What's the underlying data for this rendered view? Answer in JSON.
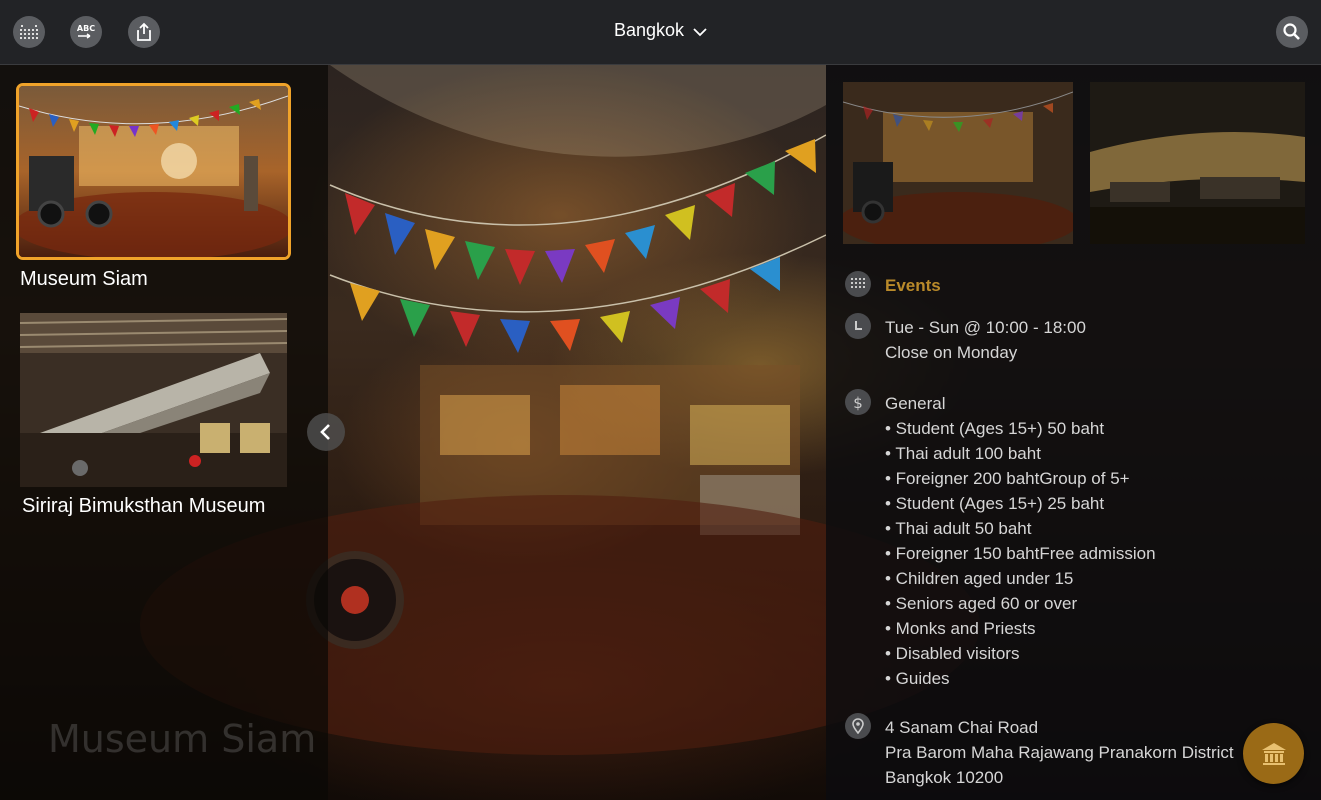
{
  "header": {
    "city": "Bangkok",
    "icons": [
      "calendar-grid-icon",
      "translate-abc-icon",
      "share-icon",
      "search-icon"
    ]
  },
  "places": [
    {
      "name": "Museum Siam",
      "selected": true
    },
    {
      "name": "Siriraj Bimuksthan Museum",
      "selected": false
    }
  ],
  "watermark": "Museum Siam",
  "details": {
    "events_label": "Events",
    "hours": [
      "Tue - Sun @ 10:00 - 18:00",
      "Close on Monday"
    ],
    "fees": [
      "General",
      "• Student (Ages 15+) 50 baht",
      "• Thai adult 100 baht",
      "• Foreigner 200 bahtGroup of 5+",
      "• Student (Ages 15+) 25 baht",
      "• Thai adult 50 baht",
      "• Foreigner 150 bahtFree admission",
      "• Children aged under 15",
      "• Seniors aged 60 or over",
      "• Monks and Priests",
      "• Disabled visitors",
      "• Guides"
    ],
    "address": [
      "4 Sanam Chai Road",
      "Pra Barom Maha Rajawang Pranakorn District",
      "Bangkok 10200"
    ]
  },
  "colors": {
    "accent": "#f0a32a",
    "events": "#b98a2a",
    "fab": "#9a6a16"
  }
}
